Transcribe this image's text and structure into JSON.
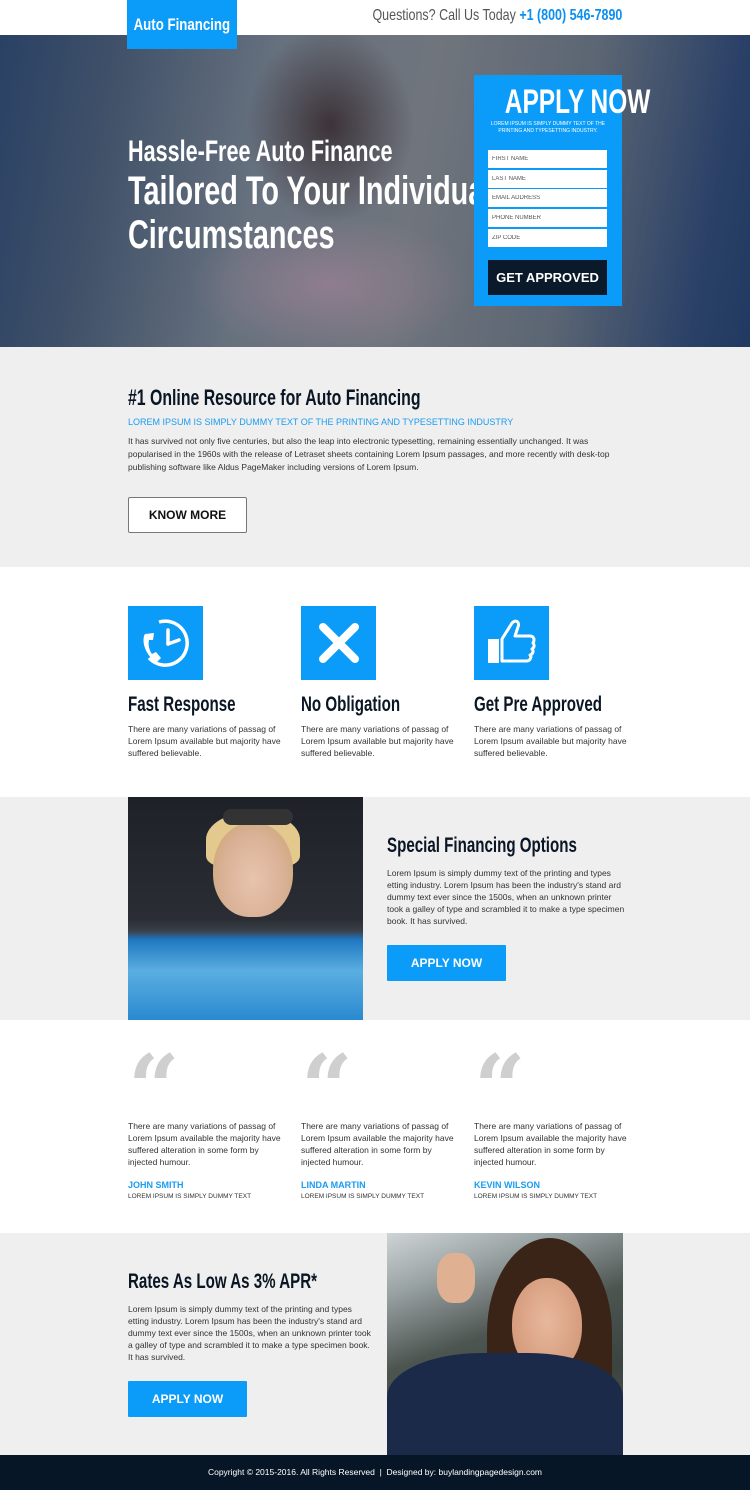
{
  "header": {
    "logo": "Auto Financing",
    "phone_prefix": "Questions? Call Us Today ",
    "phone_number": "+1 (800) 546-7890"
  },
  "hero": {
    "title_line1": "Hassle-Free Auto Finance",
    "title_line2": "Tailored To Your Individual",
    "title_line3": "Circumstances",
    "form": {
      "title": "APPLY NOW",
      "subtitle": "LOREM IPSUM IS SIMPLY DUMMY TEXT OF THE PRINTING AND TYPESETTING INDUSTRY.",
      "fields": [
        {
          "placeholder": "FIRST NAME",
          "value": ""
        },
        {
          "placeholder": "LAST NAME",
          "value": ""
        },
        {
          "placeholder": "EMAIL ADDRESS",
          "value": ""
        },
        {
          "placeholder": "PHONE NUMBER",
          "value": ""
        },
        {
          "placeholder": "ZIP CODE",
          "value": ""
        }
      ],
      "submit_label": "GET APPROVED"
    }
  },
  "resource": {
    "title": "#1 Online Resource for Auto Financing",
    "subtitle": "LOREM IPSUM IS SIMPLY DUMMY TEXT OF THE PRINTING AND TYPESETTING INDUSTRY",
    "body": "It has survived not only five centuries, but also the leap into electronic typesetting, remaining essentially unchanged. It was popularised in the 1960s with the release of Letraset sheets containing Lorem Ipsum passages, and more recently with desk-top publishing software like Aldus PageMaker including versions of Lorem Ipsum.",
    "button_label": "KNOW MORE"
  },
  "features": [
    {
      "icon": "phone-clock-icon",
      "title": "Fast Response",
      "text": "There are many variations of passag of Lorem Ipsum available but majority have suffered believable."
    },
    {
      "icon": "x-mark-icon",
      "title": "No Obligation",
      "text": "There are many variations of passag of Lorem Ipsum available but majority have suffered believable."
    },
    {
      "icon": "thumbs-up-icon",
      "title": "Get Pre Approved",
      "text": "There are many variations of passag of Lorem Ipsum available but majority have suffered believable."
    }
  ],
  "special": {
    "title": "Special Financing Options",
    "body": "Lorem Ipsum is simply dummy text of the printing and types etting industry. Lorem Ipsum has been the industry's stand ard dummy text ever since the 1500s, when an unknown printer took a galley of type and scrambled it to make a type specimen book. It has survived.",
    "button_label": "APPLY NOW"
  },
  "testimonials": [
    {
      "text": "There are many variations of passag of Lorem Ipsum available the majority have suffered alteration in some form by injected humour.",
      "name": "JOHN SMITH",
      "role": "LOREM IPSUM IS SIMPLY DUMMY TEXT"
    },
    {
      "text": "There are many variations of passag of Lorem Ipsum available the majority have suffered alteration in some form by injected humour.",
      "name": "LINDA MARTIN",
      "role": "LOREM IPSUM IS SIMPLY DUMMY TEXT"
    },
    {
      "text": "There are many variations of passag of Lorem Ipsum available the majority have suffered alteration in some form by injected humour.",
      "name": "KEVIN WILSON",
      "role": "LOREM IPSUM IS SIMPLY DUMMY TEXT"
    }
  ],
  "quote_glyph": "“",
  "rates": {
    "title": "Rates As Low As 3% APR*",
    "body": "Lorem Ipsum is simply dummy text of the printing and types etting industry. Lorem Ipsum has been the industry's stand ard dummy text ever since the 1500s, when an unknown printer took a galley of type and scrambled it to make a type specimen book. It has survived.",
    "button_label": "APPLY NOW"
  },
  "footer": {
    "text": "Copyright © 2015-2016. All Rights Reserved  |  Designed by: buylandingpagedesign.com"
  },
  "colors": {
    "accent": "#0b9bf8",
    "dark": "#071626",
    "grey_bg": "#efefef"
  }
}
